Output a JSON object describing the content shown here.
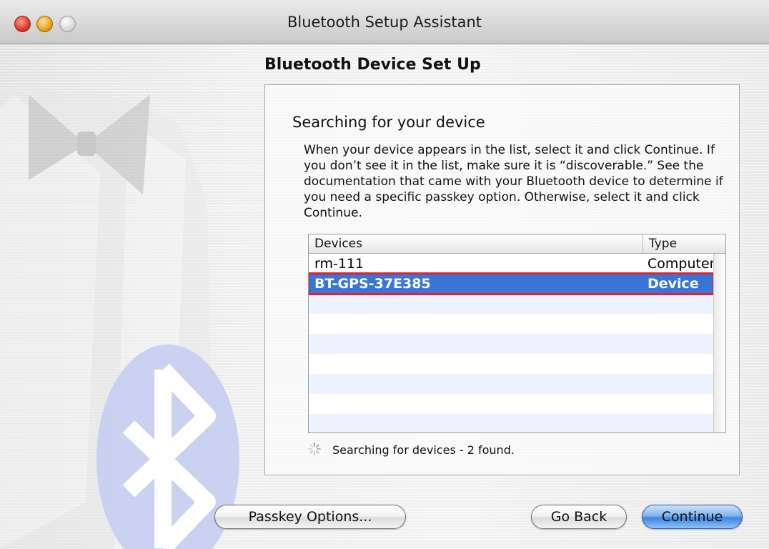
{
  "window": {
    "title": "Bluetooth Setup Assistant"
  },
  "assistant": {
    "section_title": "Bluetooth Device Set Up",
    "heading": "Searching for your device",
    "description": "When your device appears in the list, select it and click Continue. If you don’t see it in the list, make sure it is “discoverable.” See the documentation that came with your Bluetooth device to determine if you need a specific passkey option. Otherwise, select it and click Continue."
  },
  "device_table": {
    "columns": [
      "Devices",
      "Type"
    ],
    "rows": [
      {
        "device": "rm-111",
        "type": "Computer",
        "selected": false
      },
      {
        "device": "BT-GPS-37E385",
        "type": "Device",
        "selected": true
      }
    ]
  },
  "status": {
    "text": "Searching for devices - 2 found."
  },
  "buttons": {
    "passkey": "Passkey Options...",
    "go_back": "Go Back",
    "continue": "Continue"
  },
  "colors": {
    "selection": "#3875d7",
    "highlight_outline": "#e0242f",
    "default_button": "#3f86e0"
  }
}
